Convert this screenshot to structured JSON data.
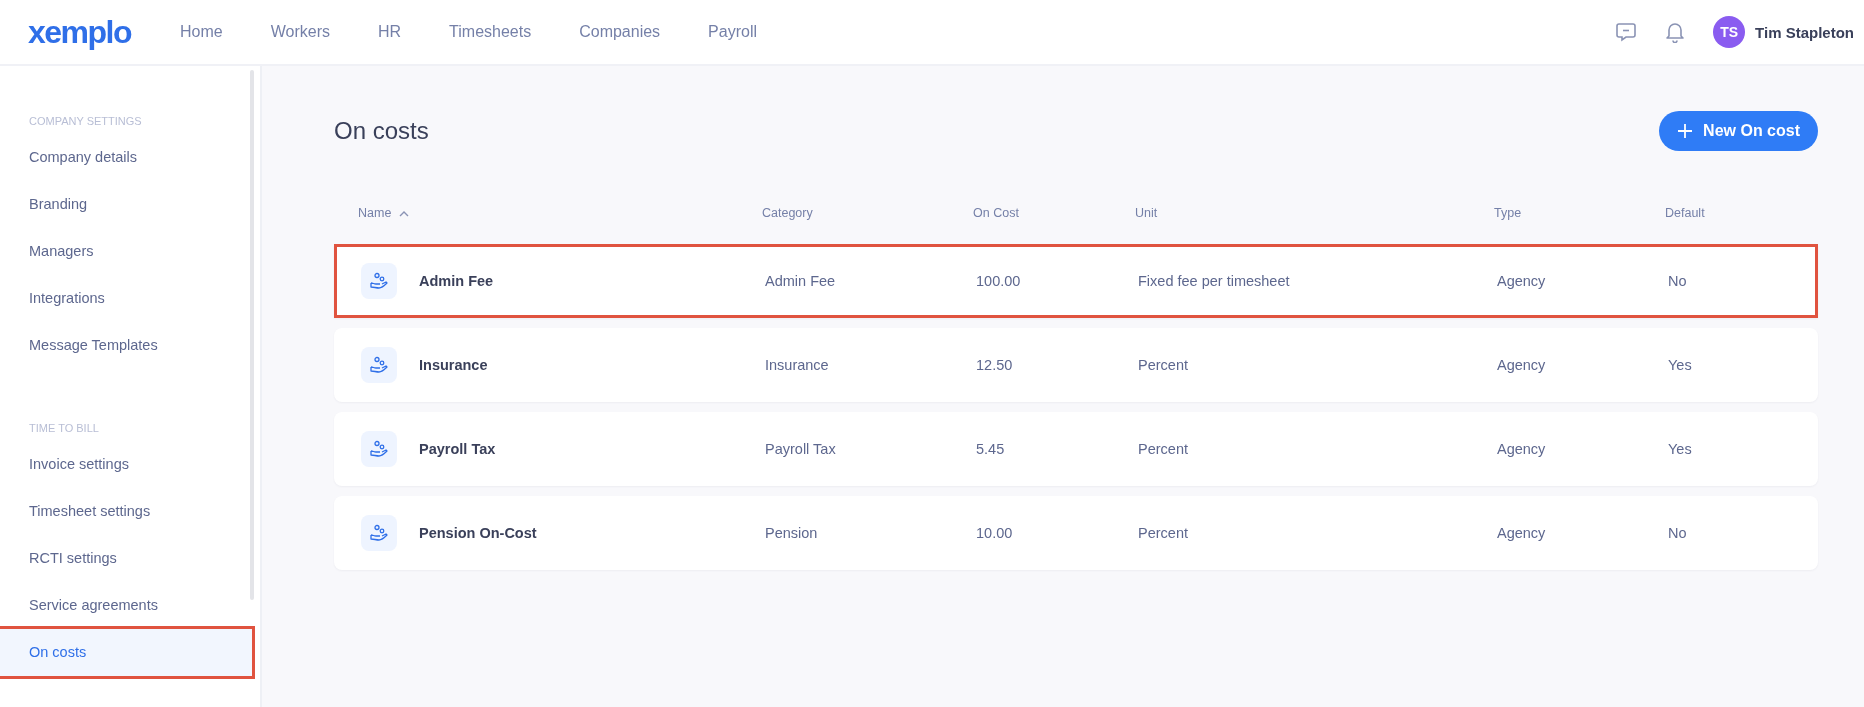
{
  "header": {
    "logo": "xemplo",
    "nav": [
      {
        "label": "Home",
        "selected": false
      },
      {
        "label": "Workers",
        "selected": false
      },
      {
        "label": "HR",
        "selected": false
      },
      {
        "label": "Timesheets",
        "selected": false
      },
      {
        "label": "Companies",
        "selected": false
      },
      {
        "label": "Payroll",
        "selected": false
      }
    ],
    "user": {
      "initials": "TS",
      "name": "Tim Stapleton"
    }
  },
  "sidebar": {
    "sections": [
      {
        "title": "COMPANY SETTINGS",
        "items": [
          {
            "label": "Company details",
            "selected": false,
            "highlighted": false
          },
          {
            "label": "Branding",
            "selected": false,
            "highlighted": false
          },
          {
            "label": "Managers",
            "selected": false,
            "highlighted": false
          },
          {
            "label": "Integrations",
            "selected": false,
            "highlighted": false
          },
          {
            "label": "Message Templates",
            "selected": false,
            "highlighted": false
          }
        ]
      },
      {
        "title": "TIME TO BILL",
        "items": [
          {
            "label": "Invoice settings",
            "selected": false,
            "highlighted": false
          },
          {
            "label": "Timesheet settings",
            "selected": false,
            "highlighted": false
          },
          {
            "label": "RCTI settings",
            "selected": false,
            "highlighted": false
          },
          {
            "label": "Service agreements",
            "selected": false,
            "highlighted": false
          },
          {
            "label": "On costs",
            "selected": true,
            "highlighted": true
          }
        ]
      }
    ]
  },
  "page": {
    "title": "On costs",
    "new_button": "New On cost"
  },
  "table": {
    "columns": [
      "Name",
      "Category",
      "On Cost",
      "Unit",
      "Type",
      "Default"
    ],
    "rows": [
      {
        "name": "Admin Fee",
        "category": "Admin Fee",
        "on_cost": "100.00",
        "unit": "Fixed fee per timesheet",
        "type": "Agency",
        "default": "No",
        "highlighted": true
      },
      {
        "name": "Insurance",
        "category": "Insurance",
        "on_cost": "12.50",
        "unit": "Percent",
        "type": "Agency",
        "default": "Yes",
        "highlighted": false
      },
      {
        "name": "Payroll Tax",
        "category": "Payroll Tax",
        "on_cost": "5.45",
        "unit": "Percent",
        "type": "Agency",
        "default": "Yes",
        "highlighted": false
      },
      {
        "name": "Pension On-Cost",
        "category": "Pension",
        "on_cost": "10.00",
        "unit": "Percent",
        "type": "Agency",
        "default": "No",
        "highlighted": false
      }
    ]
  }
}
